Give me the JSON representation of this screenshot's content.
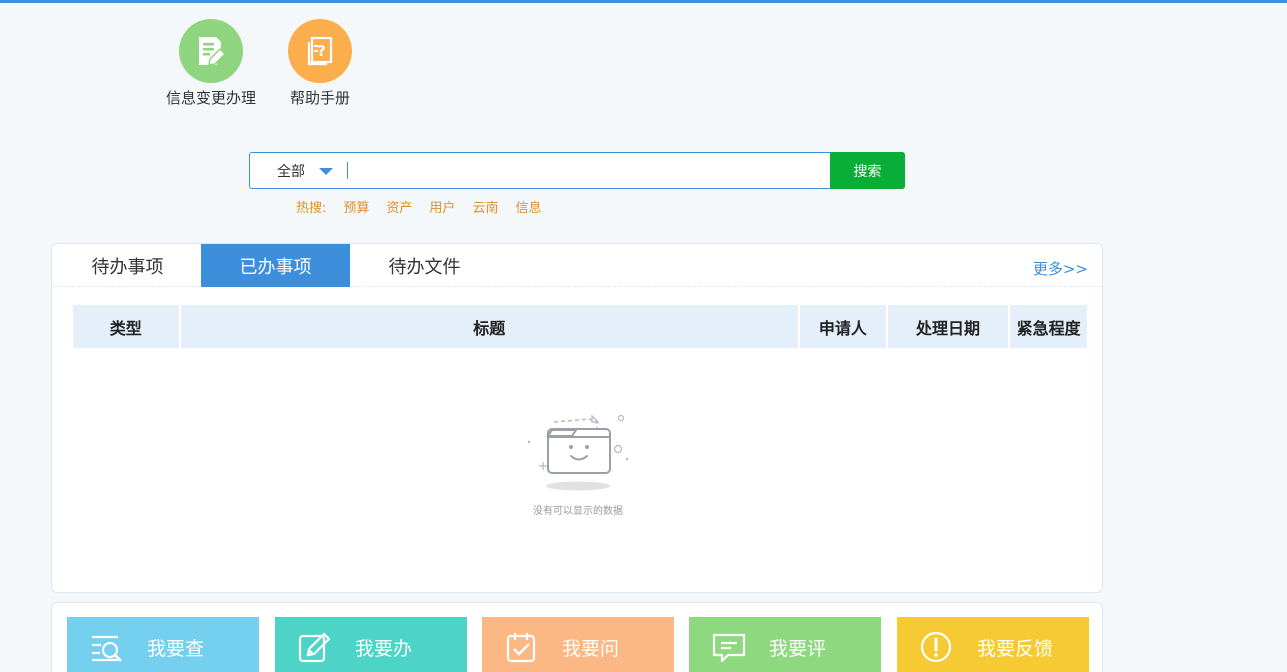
{
  "colors": {
    "accent": "#3d8fdc",
    "search_button": "#08ae38",
    "hot_keywords": "#e0902a"
  },
  "quick_apps": [
    {
      "label": "信息变更办理",
      "icon": "document-edit-icon",
      "color": "#8fd57f"
    },
    {
      "label": "帮助手册",
      "icon": "help-manual-icon",
      "color": "#fcae4c"
    }
  ],
  "search": {
    "scope": "全部",
    "placeholder": "",
    "button": "搜索",
    "hot_label": "热搜:",
    "hot_keywords": [
      "预算",
      "资产",
      "用户",
      "云南",
      "信息"
    ]
  },
  "panel": {
    "tabs": [
      "待办事项",
      "已办事项",
      "待办文件"
    ],
    "active_tab": 1,
    "more": "更多>>",
    "columns": [
      "类型",
      "标题",
      "申请人",
      "处理日期",
      "紧急程度"
    ],
    "empty_text": "没有可以显示的数据"
  },
  "actions": [
    {
      "label": "我要查",
      "icon": "search-list-icon",
      "color": "#75d0ef"
    },
    {
      "label": "我要办",
      "icon": "edit-icon",
      "color": "#4ed3c7"
    },
    {
      "label": "我要问",
      "icon": "calendar-check-icon",
      "color": "#fbb884"
    },
    {
      "label": "我要评",
      "icon": "comment-icon",
      "color": "#8ed880"
    },
    {
      "label": "我要反馈",
      "icon": "alert-icon",
      "color": "#f5ca32"
    }
  ]
}
